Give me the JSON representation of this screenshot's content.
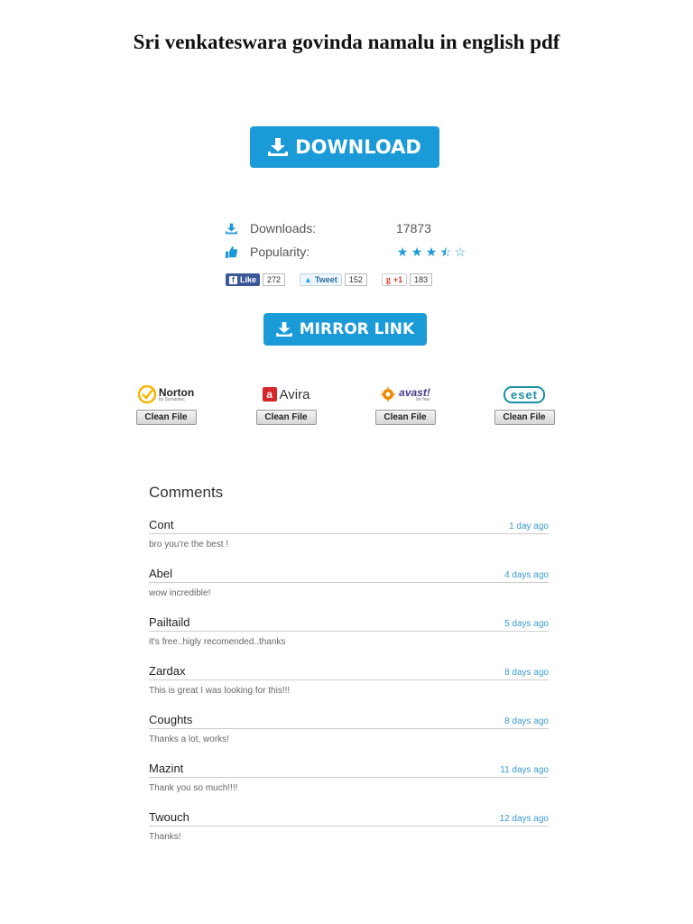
{
  "page": {
    "title": "Sri venkateswara govinda namalu in english pdf"
  },
  "buttons": {
    "download": "DOWNLOAD",
    "mirror": "MIRROR LINK"
  },
  "stats": {
    "downloads_label": "Downloads:",
    "downloads_value": "17873",
    "popularity_label": "Popularity:",
    "popularity_stars": 3.5,
    "popularity_max": 5
  },
  "social": {
    "facebook": {
      "label": "Like",
      "count": "272"
    },
    "twitter": {
      "label": "Tweet",
      "count": "152"
    },
    "googleplus": {
      "label": "+1",
      "count": "183"
    }
  },
  "antivirus": [
    {
      "name": "Norton",
      "sub": "by Symantec",
      "button": "Clean File",
      "color": "#f7b500"
    },
    {
      "name": "Avira",
      "button": "Clean File",
      "color": "#d7262b"
    },
    {
      "name": "avast!",
      "sub": "be free",
      "button": "Clean File",
      "color": "#f08a00"
    },
    {
      "name": "eset",
      "button": "Clean File",
      "color": "#1a8fa6"
    }
  ],
  "comments": {
    "heading": "Comments",
    "items": [
      {
        "author": "Cont",
        "time": "1 day ago",
        "text": "bro you're the best !"
      },
      {
        "author": "Abel",
        "time": "4 days ago",
        "text": "wow incredible!"
      },
      {
        "author": "Pailtaild",
        "time": "5 days ago",
        "text": "it's free..higly recomended..thanks"
      },
      {
        "author": "Zardax",
        "time": "8 days ago",
        "text": "This is great I was looking for this!!!"
      },
      {
        "author": "Coughts",
        "time": "8 days ago",
        "text": "Thanks a lot, works!"
      },
      {
        "author": "Mazint",
        "time": "11 days ago",
        "text": "Thank you so much!!!!"
      },
      {
        "author": "Twouch",
        "time": "12 days ago",
        "text": "Thanks!"
      }
    ]
  },
  "colors": {
    "accent": "#1a9ad6",
    "link": "#3a9bd0"
  }
}
